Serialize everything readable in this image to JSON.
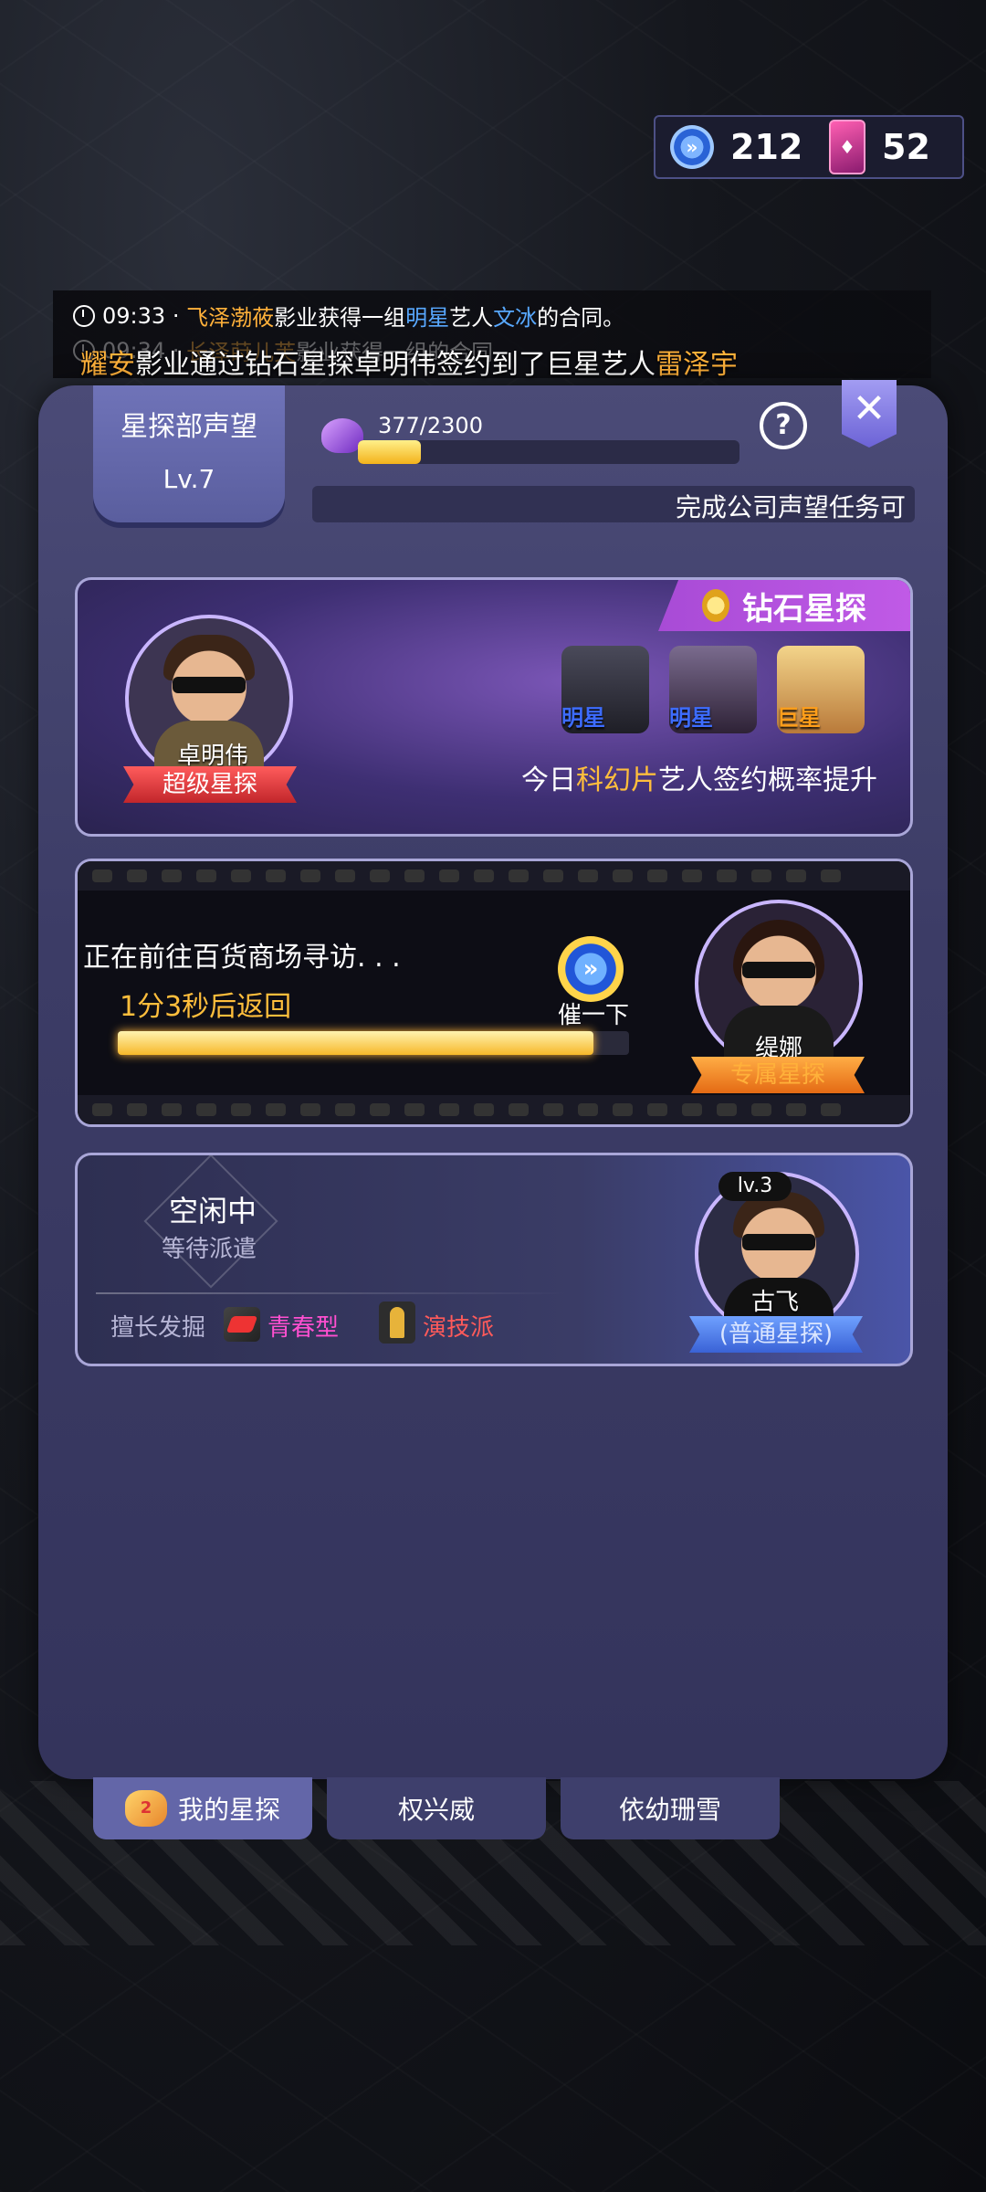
{
  "currency": {
    "speedup_icon": "clock-speedup-icon",
    "speedup_count": "212",
    "card_icon": "diamond-card-icon",
    "card_count": "52"
  },
  "ticker": {
    "line1": {
      "time": "09:33",
      "sep": "·",
      "company": "飞泽渤莜",
      "text1": "影业获得一组",
      "tier": "明星",
      "text2": "艺人",
      "artist": "文冰",
      "text3": "的合同。"
    },
    "line2": {
      "time": "09:34",
      "sep": "·",
      "company": "长泽莳儿芙",
      "text1": "影业获得一组",
      "tier": "",
      "text2": "",
      "artist": "",
      "text3": "的合同"
    },
    "headline": {
      "company": "耀安",
      "text1": "影业通过钻石星探卓明伟签约到了巨星艺人",
      "artist": "雷泽宇"
    }
  },
  "reputation": {
    "title": "星探部声望",
    "level": "Lv.7",
    "progress_text": "377/2300",
    "progress_fraction": 0.164,
    "task_text": "完成公司声望任务可"
  },
  "cards": {
    "diamond": {
      "badge": "钻石星探",
      "scout_name": "卓明伟",
      "scout_rank": "超级星探",
      "stars": [
        {
          "label": "明星",
          "color": "#3d6cff"
        },
        {
          "label": "明星",
          "color": "#3d6cff"
        },
        {
          "label": "巨星",
          "color": "#ff9e1a"
        }
      ],
      "promo_prefix": "今日",
      "promo_genre": "科幻片",
      "promo_suffix": "艺人签约概率提升"
    },
    "exclusive": {
      "status": "正在前往百货商场寻访. . .",
      "return_time": "1分3秒后返回",
      "progress_fraction": 0.93,
      "hurry_label": "催一下",
      "scout_name": "缇娜",
      "scout_rank": "专属星探"
    },
    "normal": {
      "status": "空闲中",
      "sub_status": "等待派遣",
      "skill_label": "擅长发掘",
      "skill1": "青春型",
      "skill2": "演技派",
      "level": "lv.3",
      "scout_name": "古飞",
      "scout_rank": "(普通星探)"
    }
  },
  "tabs": [
    {
      "label": "我的星探",
      "active": true
    },
    {
      "label": "权兴威",
      "active": false
    },
    {
      "label": "依幼珊雪",
      "active": false
    }
  ],
  "colors": {
    "accent": "#6366a8",
    "gold": "#ffbe3c",
    "orange": "#ffb13a",
    "blue": "#58a8ff"
  }
}
